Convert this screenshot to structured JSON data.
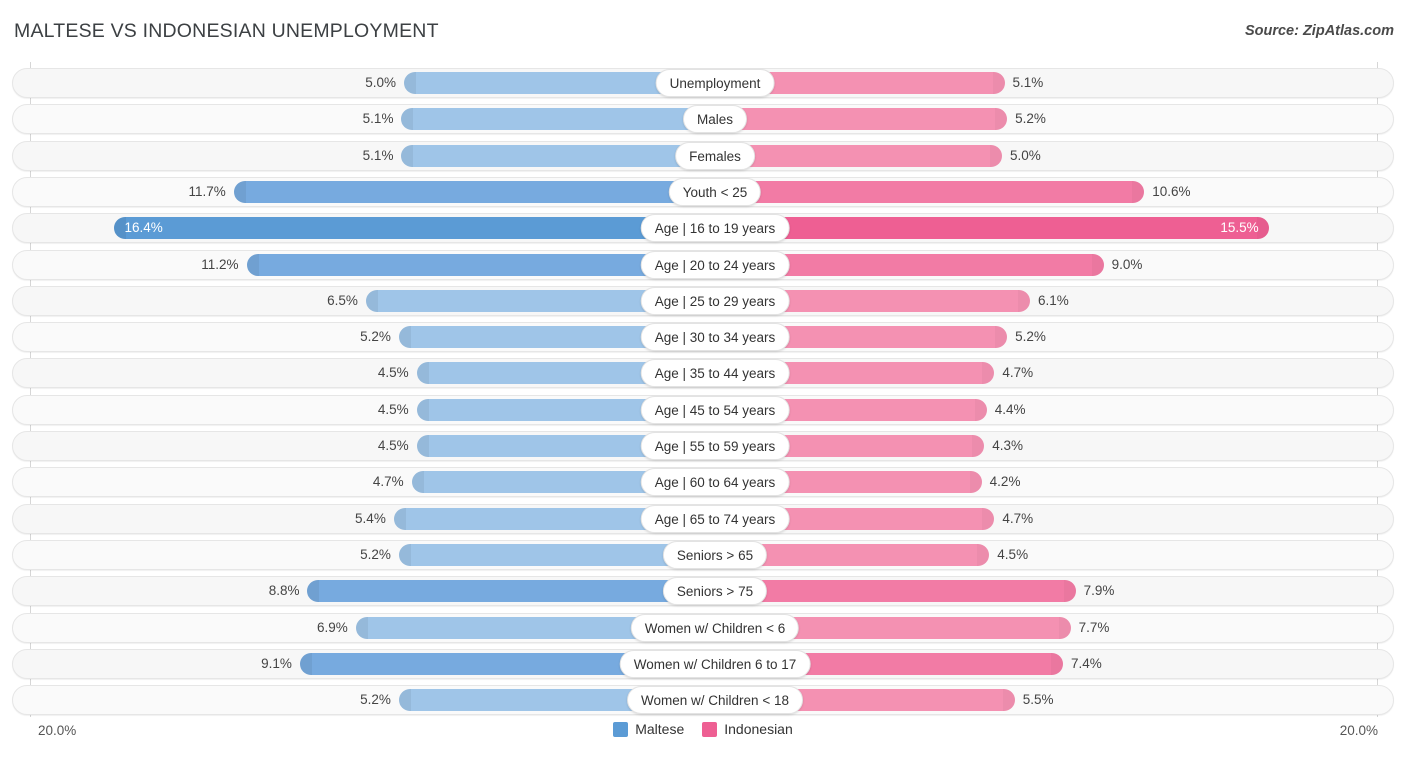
{
  "header": {
    "title": "MALTESE VS INDONESIAN UNEMPLOYMENT",
    "source": "Source: ZipAtlas.com"
  },
  "axis": {
    "left_label": "20.0%",
    "right_label": "20.0%",
    "max": 20.0
  },
  "legend": {
    "items": [
      {
        "label": "Maltese",
        "color": "#5b9bd5"
      },
      {
        "label": "Indonesian",
        "color": "#ee5f93"
      }
    ]
  },
  "colors": {
    "left_normal": "#9fc5e8",
    "left_strong": "#77aadf",
    "left_highlight": "#5b9bd5",
    "right_normal": "#f491b2",
    "right_strong": "#f27ba5",
    "right_highlight": "#ee5f93",
    "track": "#f7f7f7",
    "track_border": "#e6e6e6"
  },
  "chart_data": {
    "type": "bar",
    "subtype": "diverging-bidirectional",
    "title": "MALTESE VS INDONESIAN UNEMPLOYMENT",
    "xlabel": "",
    "ylabel": "",
    "xlim": [
      20.0,
      20.0
    ],
    "grid": false,
    "legend_position": "bottom-center",
    "categories": [
      "Unemployment",
      "Males",
      "Females",
      "Youth < 25",
      "Age | 16 to 19 years",
      "Age | 20 to 24 years",
      "Age | 25 to 29 years",
      "Age | 30 to 34 years",
      "Age | 35 to 44 years",
      "Age | 45 to 54 years",
      "Age | 55 to 59 years",
      "Age | 60 to 64 years",
      "Age | 65 to 74 years",
      "Seniors > 65",
      "Seniors > 75",
      "Women w/ Children < 6",
      "Women w/ Children 6 to 17",
      "Women w/ Children < 18"
    ],
    "series": [
      {
        "name": "Maltese",
        "color": "#5b9bd5",
        "values": [
          5.0,
          5.1,
          5.1,
          11.7,
          16.4,
          11.2,
          6.5,
          5.2,
          4.5,
          4.5,
          4.5,
          4.7,
          5.4,
          5.2,
          8.8,
          6.9,
          9.1,
          5.2
        ]
      },
      {
        "name": "Indonesian",
        "color": "#ee5f93",
        "values": [
          5.1,
          5.2,
          5.0,
          10.6,
          15.5,
          9.0,
          6.1,
          5.2,
          4.7,
          4.4,
          4.3,
          4.2,
          4.7,
          4.5,
          7.9,
          7.7,
          7.4,
          5.5
        ]
      }
    ]
  },
  "rows": [
    {
      "category": "Unemployment",
      "left": "5.0%",
      "right": "5.1%",
      "left_val": 5.0,
      "right_val": 5.1,
      "emphasis": "normal"
    },
    {
      "category": "Males",
      "left": "5.1%",
      "right": "5.2%",
      "left_val": 5.1,
      "right_val": 5.2,
      "emphasis": "normal"
    },
    {
      "category": "Females",
      "left": "5.1%",
      "right": "5.0%",
      "left_val": 5.1,
      "right_val": 5.0,
      "emphasis": "normal"
    },
    {
      "category": "Youth < 25",
      "left": "11.7%",
      "right": "10.6%",
      "left_val": 11.7,
      "right_val": 10.6,
      "emphasis": "strong"
    },
    {
      "category": "Age | 16 to 19 years",
      "left": "16.4%",
      "right": "15.5%",
      "left_val": 16.4,
      "right_val": 15.5,
      "emphasis": "highlight"
    },
    {
      "category": "Age | 20 to 24 years",
      "left": "11.2%",
      "right": "9.0%",
      "left_val": 11.2,
      "right_val": 9.0,
      "emphasis": "strong"
    },
    {
      "category": "Age | 25 to 29 years",
      "left": "6.5%",
      "right": "6.1%",
      "left_val": 6.5,
      "right_val": 6.1,
      "emphasis": "normal"
    },
    {
      "category": "Age | 30 to 34 years",
      "left": "5.2%",
      "right": "5.2%",
      "left_val": 5.2,
      "right_val": 5.2,
      "emphasis": "normal"
    },
    {
      "category": "Age | 35 to 44 years",
      "left": "4.5%",
      "right": "4.7%",
      "left_val": 4.5,
      "right_val": 4.7,
      "emphasis": "normal"
    },
    {
      "category": "Age | 45 to 54 years",
      "left": "4.5%",
      "right": "4.4%",
      "left_val": 4.5,
      "right_val": 4.4,
      "emphasis": "normal"
    },
    {
      "category": "Age | 55 to 59 years",
      "left": "4.5%",
      "right": "4.3%",
      "left_val": 4.5,
      "right_val": 4.3,
      "emphasis": "normal"
    },
    {
      "category": "Age | 60 to 64 years",
      "left": "4.7%",
      "right": "4.2%",
      "left_val": 4.7,
      "right_val": 4.2,
      "emphasis": "normal"
    },
    {
      "category": "Age | 65 to 74 years",
      "left": "5.4%",
      "right": "4.7%",
      "left_val": 5.4,
      "right_val": 4.7,
      "emphasis": "normal"
    },
    {
      "category": "Seniors > 65",
      "left": "5.2%",
      "right": "4.5%",
      "left_val": 5.2,
      "right_val": 4.5,
      "emphasis": "normal"
    },
    {
      "category": "Seniors > 75",
      "left": "8.8%",
      "right": "7.9%",
      "left_val": 8.8,
      "right_val": 7.9,
      "emphasis": "strong"
    },
    {
      "category": "Women w/ Children < 6",
      "left": "6.9%",
      "right": "7.7%",
      "left_val": 6.9,
      "right_val": 7.7,
      "emphasis": "normal"
    },
    {
      "category": "Women w/ Children 6 to 17",
      "left": "9.1%",
      "right": "7.4%",
      "left_val": 9.1,
      "right_val": 7.4,
      "emphasis": "strong"
    },
    {
      "category": "Women w/ Children < 18",
      "left": "5.2%",
      "right": "5.5%",
      "left_val": 5.2,
      "right_val": 5.5,
      "emphasis": "normal"
    }
  ]
}
